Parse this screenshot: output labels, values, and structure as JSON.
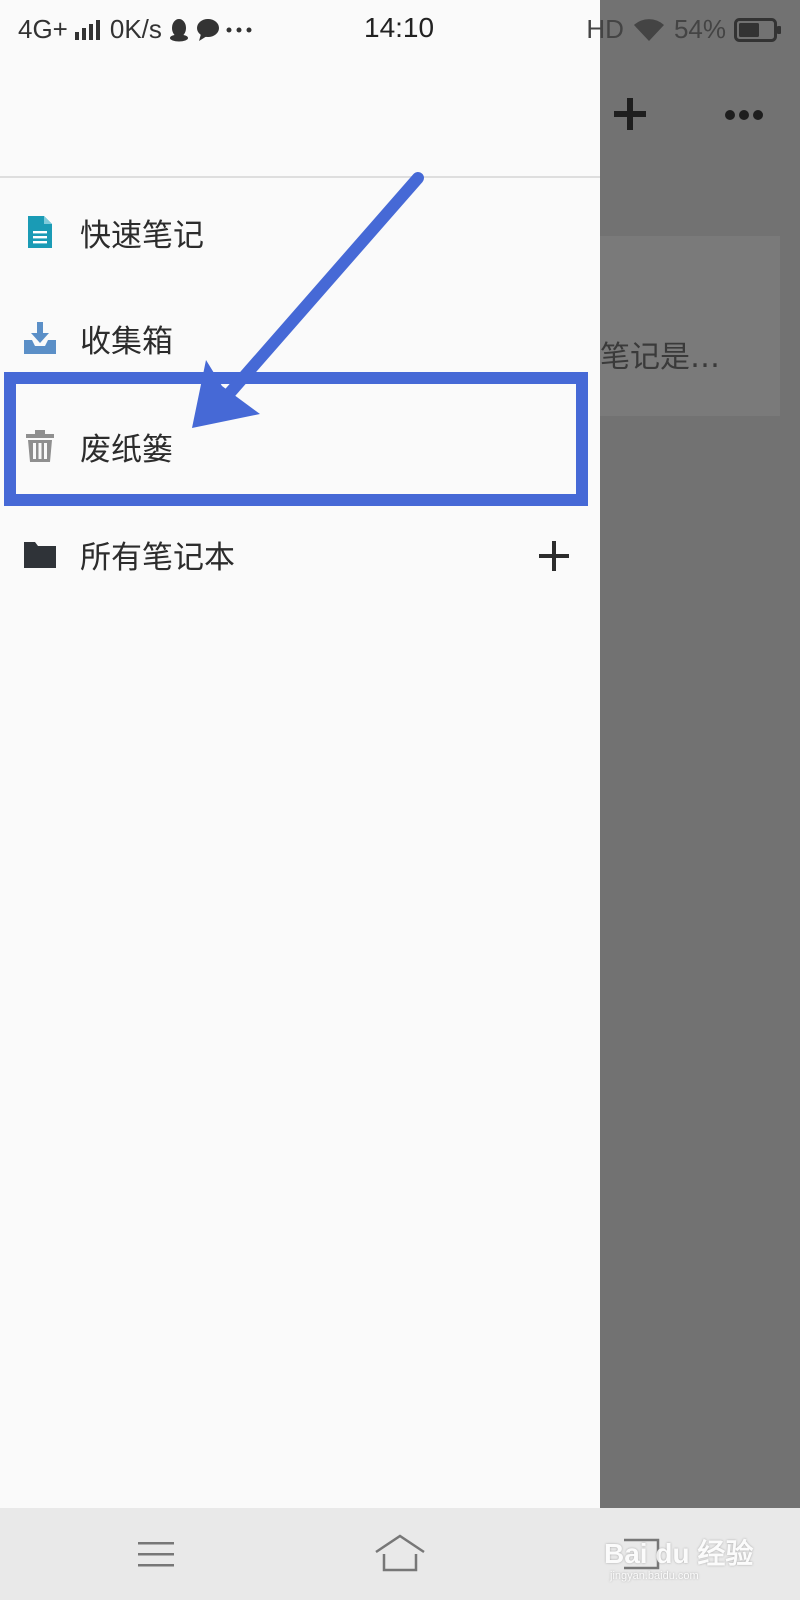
{
  "status_bar": {
    "network": "4G+",
    "speed": "0K/s",
    "time": "14:10",
    "hd": "HD",
    "battery": "54%"
  },
  "drawer": {
    "items": [
      {
        "label": "快速笔记",
        "icon": "note-icon",
        "color": "#1a9bb5"
      },
      {
        "label": "收集箱",
        "icon": "inbox-download-icon",
        "color": "#5b8fc7"
      },
      {
        "label": "废纸篓",
        "icon": "trash-icon",
        "color": "#8f8f8f"
      },
      {
        "label": "所有笔记本",
        "icon": "folder-icon",
        "color": "#2f3338"
      }
    ]
  },
  "background": {
    "card_text": "笔记是…"
  },
  "watermark": {
    "brand": "Bai du 经验",
    "url": "jingyan.baidu.com"
  },
  "colors": {
    "highlight": "#4669d6",
    "overlay": "#727272"
  }
}
